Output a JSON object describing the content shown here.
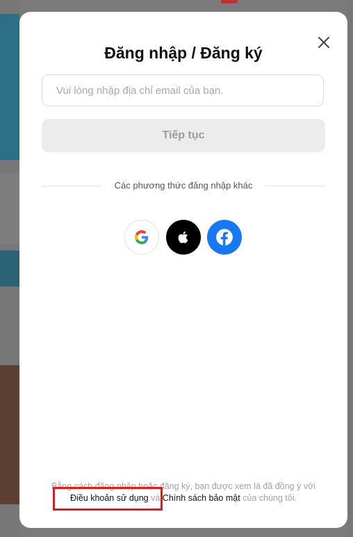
{
  "modal": {
    "title": "Đăng nhập / Đăng ký",
    "close_icon": "close-icon",
    "email_placeholder": "Vui lòng nhập địa chỉ email của bạn.",
    "email_value": "",
    "continue_label": "Tiếp tục",
    "divider_text": "Các phương thức đăng nhập khác",
    "social": [
      {
        "name": "google",
        "icon": "google-icon"
      },
      {
        "name": "apple",
        "icon": "apple-icon"
      },
      {
        "name": "facebook",
        "icon": "facebook-icon"
      }
    ],
    "terms": {
      "prefix": "Bằng cách đăng nhập hoặc đăng ký, bạn được xem là đã đồng ý với",
      "terms_link": "Điều khoản sử dụng",
      "and": " và ",
      "privacy_link": "Chính sách bảo mật",
      "suffix": " của chúng tôi."
    }
  },
  "colors": {
    "facebook": "#1877f2",
    "apple": "#000000",
    "highlight": "#e01b1b",
    "button_bg": "#ececec"
  }
}
